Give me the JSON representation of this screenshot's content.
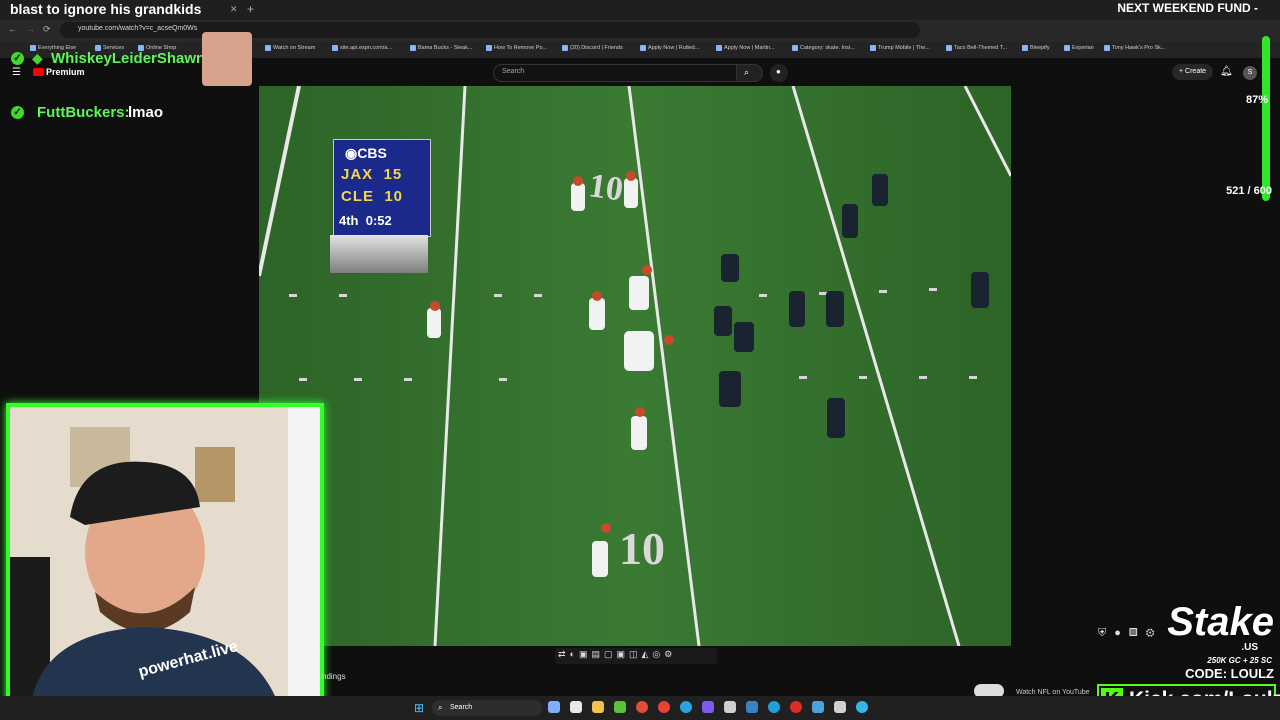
{
  "browser": {
    "tab_title": "blast to ignore his grandkids",
    "url": "youtube.com/watch?v=c_acseQm0Ws",
    "bookmarks": [
      "Everything Else",
      "Services",
      "Online Shop",
      "Watch on Stream",
      "site.api.espn.com/a...",
      "Bama Bucks - Steak...",
      "How To Remove Po...",
      "(20) Discord | Friends",
      "Apply Now | Rutled...",
      "Apply Now | Martin...",
      "Category: skate. Insi...",
      "Trump Mobile | The...",
      "Taco Bell-Themed T...",
      "Bleepify",
      "Experian",
      "Tony Hawk's Pro Sk..."
    ]
  },
  "overlay": {
    "fund_title": "NEXT WEEKEND FUND -",
    "fund_percent": "87%",
    "fund_count": "521 / 600",
    "chat": [
      {
        "user": "WhiskeyLeiderShawn:",
        "message": ""
      },
      {
        "user": "FuttBuckers:",
        "message": "lmao"
      }
    ],
    "stake": {
      "logo": "Stake",
      "region": ".US",
      "bonus": "250K GC + 25 SC",
      "code": "CODE: LOULZ"
    },
    "kick": "Kick.com/Loulz"
  },
  "youtube": {
    "search_placeholder": "Search",
    "create_label": "Create",
    "premium_label": "Premium",
    "avatar_letter": "S",
    "below_video_text": "ndings",
    "recommended_text": "Watch NFL on YouTube"
  },
  "video": {
    "scorebug": {
      "network": "CBS",
      "team1": "JAX",
      "score1": "15",
      "team2": "CLE",
      "score2": "10",
      "quarter": "4th",
      "clock": "0:52"
    },
    "yard_marker_top": "10",
    "yard_marker_bottom": "10"
  },
  "taskbar": {
    "search_label": "Search"
  },
  "colors": {
    "field": "#2f6b2a",
    "overlay_green": "#31ff2b",
    "kick_green": "#53fc18",
    "cbs_blue": "#1b2a8a"
  }
}
